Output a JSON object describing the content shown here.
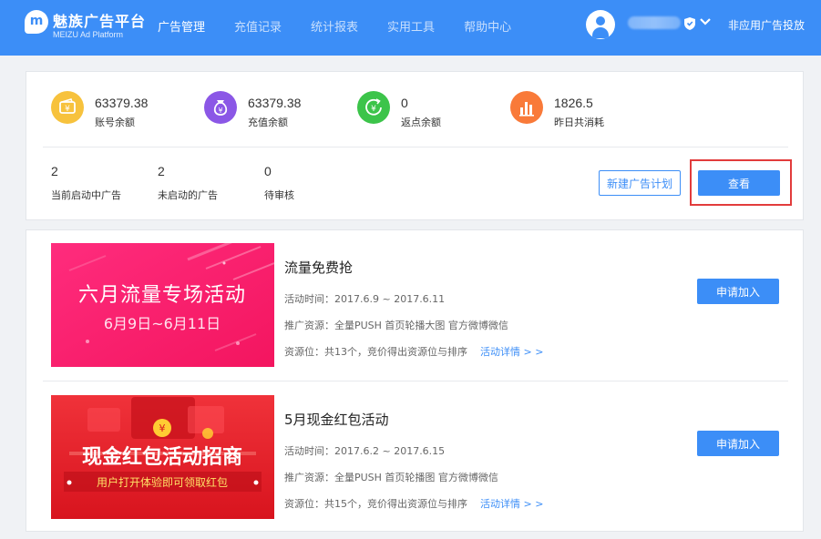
{
  "header": {
    "logo_letter": "m",
    "brand": "魅族广告平台",
    "brand_sub": "MEIZU Ad Platform",
    "nav": [
      {
        "label": "广告管理",
        "active": true
      },
      {
        "label": "充值记录",
        "active": false
      },
      {
        "label": "统计报表",
        "active": false
      },
      {
        "label": "实用工具",
        "active": false
      },
      {
        "label": "帮助中心",
        "active": false
      }
    ],
    "non_app_link": "非应用广告投放",
    "icons": [
      "user-avatar-icon",
      "shield-icon",
      "chevron-down-icon"
    ]
  },
  "stats": [
    {
      "value": "63379.38",
      "label": "账号余额",
      "color": "#f7c23d",
      "icon": "wallet-icon"
    },
    {
      "value": "63379.38",
      "label": "充值余额",
      "color": "#8b57e6",
      "icon": "money-bag-icon"
    },
    {
      "value": "0",
      "label": "返点余额",
      "color": "#3cc44a",
      "icon": "rebate-cycle-icon"
    },
    {
      "value": "1826.5",
      "label": "昨日共消耗",
      "color": "#f97a39",
      "icon": "bar-chart-icon"
    }
  ],
  "counts": [
    {
      "value": "2",
      "label": "当前启动中广告"
    },
    {
      "value": "2",
      "label": "未启动的广告"
    },
    {
      "value": "0",
      "label": "待审核"
    }
  ],
  "buttons": {
    "new_plan": "新建广告计划",
    "view": "查看"
  },
  "activities": [
    {
      "title": "流量免费抢",
      "time": "活动时间：2017.6.9 ~ 2017.6.11",
      "resource": "推广资源：全量PUSH  首页轮播大图  官方微博微信",
      "slots": "资源位：共13个，竞价得出资源位与排序",
      "detail_link": "活动详情 > >",
      "join": "申请加入",
      "banner": {
        "line1": "六月流量专场活动",
        "line2": "6月9日~6月11日"
      }
    },
    {
      "title": "5月现金红包活动",
      "time": "活动时间：2017.6.2 ~ 2017.6.15",
      "resource": "推广资源：全量PUSH  首页轮播图 官方微博微信",
      "slots": "资源位：共15个，竞价得出资源位与排序",
      "detail_link": "活动详情 > >",
      "join": "申请加入",
      "banner": {
        "line1": "现金红包活动招商",
        "line2": "用户打开体验即可领取红包",
        "coin": "¥"
      }
    }
  ],
  "colors": {
    "primary": "#3c8ef7",
    "highlight_border": "#e23c3c"
  }
}
